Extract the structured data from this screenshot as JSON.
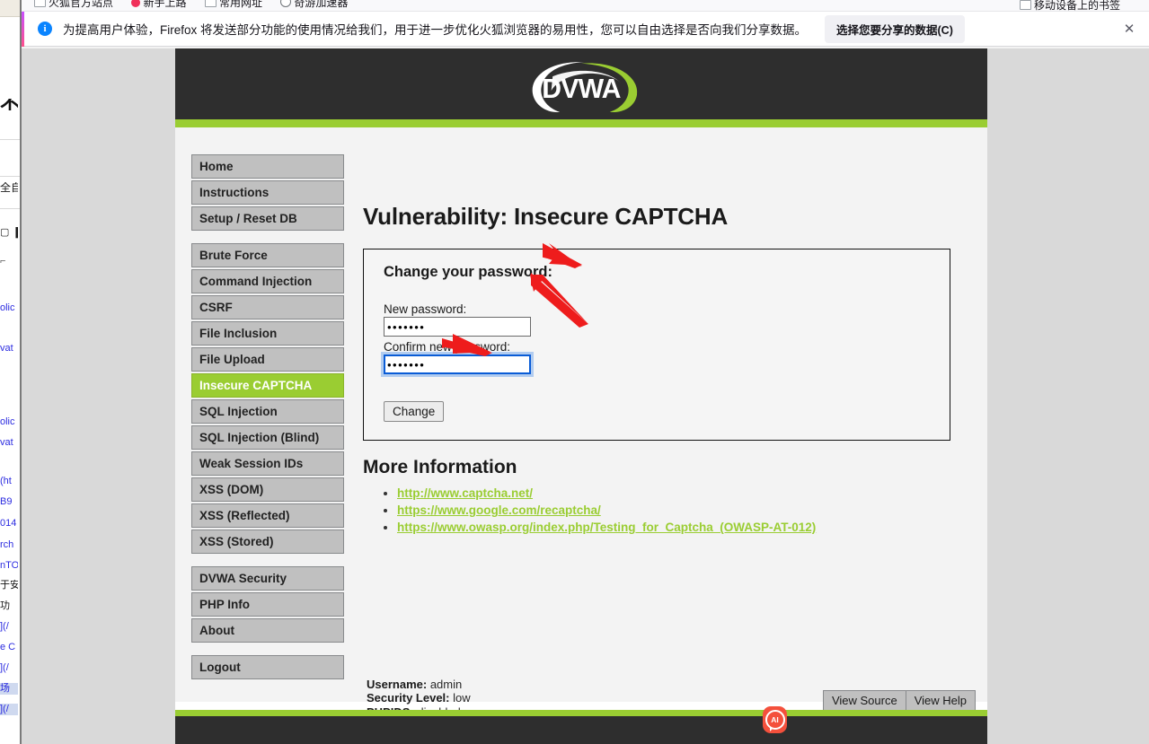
{
  "browser": {
    "bookmarks": [
      {
        "label": "火狐官方站点",
        "icon": "page-icon"
      },
      {
        "label": "新手上路",
        "icon": "red-dot-icon"
      },
      {
        "label": "常用网址",
        "icon": "page-icon"
      },
      {
        "label": "奇游加速器",
        "icon": "globe-icon"
      }
    ],
    "bookmarks_right": {
      "label": "移动设备上的书签",
      "icon": "page-icon"
    },
    "notification": {
      "icon": "info-icon",
      "text": "为提高用户体验，Firefox 将发送部分功能的使用情况给我们，用于进一步优化火狐浏览器的易用性，您可以自由选择是否向我们分享数据。",
      "button_label": "选择您要分享的数据(C)",
      "close_icon": "close-icon"
    }
  },
  "background_window": {
    "tab_label": "不",
    "fragments": [
      "全自",
      "olic",
      "vat",
      "olic",
      "vat",
      "(ht",
      "B9",
      "014",
      "rch",
      "nTO",
      "于安",
      "功",
      "](/",
      "e C",
      "](/",
      "场",
      "](/"
    ]
  },
  "site": {
    "logo_text": "DVWA",
    "accent_green": "#9acd32",
    "header_bg": "#2e2e2e"
  },
  "sidebar": {
    "groups": [
      {
        "items": [
          {
            "label": "Home",
            "active": false
          },
          {
            "label": "Instructions",
            "active": false
          },
          {
            "label": "Setup / Reset DB",
            "active": false
          }
        ]
      },
      {
        "items": [
          {
            "label": "Brute Force",
            "active": false
          },
          {
            "label": "Command Injection",
            "active": false
          },
          {
            "label": "CSRF",
            "active": false
          },
          {
            "label": "File Inclusion",
            "active": false
          },
          {
            "label": "File Upload",
            "active": false
          },
          {
            "label": "Insecure CAPTCHA",
            "active": true
          },
          {
            "label": "SQL Injection",
            "active": false
          },
          {
            "label": "SQL Injection (Blind)",
            "active": false
          },
          {
            "label": "Weak Session IDs",
            "active": false
          },
          {
            "label": "XSS (DOM)",
            "active": false
          },
          {
            "label": "XSS (Reflected)",
            "active": false
          },
          {
            "label": "XSS (Stored)",
            "active": false
          }
        ]
      },
      {
        "items": [
          {
            "label": "DVWA Security",
            "active": false
          },
          {
            "label": "PHP Info",
            "active": false
          },
          {
            "label": "About",
            "active": false
          }
        ]
      },
      {
        "items": [
          {
            "label": "Logout",
            "active": false
          }
        ]
      }
    ]
  },
  "main": {
    "page_title": "Vulnerability: Insecure CAPTCHA",
    "form": {
      "heading": "Change your password:",
      "new_password": {
        "label": "New password:",
        "value": "•••••••",
        "placeholder": ""
      },
      "confirm_password": {
        "label": "Confirm new password:",
        "value": "•••••••",
        "placeholder": ""
      },
      "submit_label": "Change"
    },
    "more_information": {
      "heading": "More Information",
      "links": [
        "http://www.captcha.net/",
        "https://www.google.com/recaptcha/",
        "https://www.owasp.org/index.php/Testing_for_Captcha_(OWASP-AT-012)"
      ]
    }
  },
  "footer": {
    "username_label": "Username:",
    "username_value": "admin",
    "security_label": "Security Level:",
    "security_value": "low",
    "phpids_label": "PHPIDS:",
    "phpids_value": "disabled",
    "view_source_label": "View Source",
    "view_help_label": "View Help"
  },
  "overlay": {
    "ai_button_label": "AI"
  }
}
